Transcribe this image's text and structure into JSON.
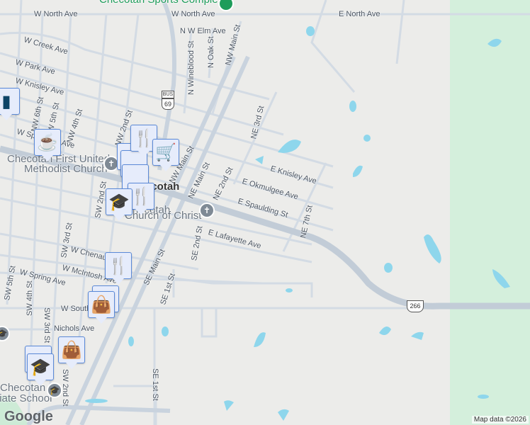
{
  "map": {
    "colors": {
      "land": "#ececea",
      "road": "#d3dbe4",
      "water": "#8ed6ec",
      "park": "#d4efdc",
      "marker_bg": "#e6ecfb",
      "marker_border": "#5b8ad8",
      "marker_icon": "#0d4466"
    },
    "pois": {
      "sports_complex": "Checotah Sports Complex",
      "methodist_line1": "Checotah First United",
      "methodist_line2": "Methodist Church",
      "church_of_christ_line1": "Checotah",
      "church_of_christ_line2": "Church of Christ",
      "town": "Checotah",
      "school_line1": "Checotah",
      "school_line2": "Intermediate School"
    },
    "streets": {
      "w_north_1": "W North Ave",
      "w_north_2": "W North Ave",
      "e_north": "E North Ave",
      "nw_elm": "N W Elm Ave",
      "w_creek": "W Creek Ave",
      "w_park": "W Park Ave",
      "w_knisley": "W Knisley Ave",
      "nw6": "NW 6th St",
      "nw5": "NW 5th St",
      "nw4": "NW 4th St",
      "nw2": "NW 2nd St",
      "wineblood": "N Wineblood St",
      "oak": "N Oak St",
      "nw_main": "NW Main St",
      "nw_main2": "NW Main St",
      "ne3": "NE 3rd St",
      "w_spaulding": "W Spaulding Ave",
      "ne_main": "NE Main St",
      "ne2": "NE 2nd St",
      "e_knisley": "E Knisley Ave",
      "e_okmulgee": "E Okmulgee Ave",
      "e_spaulding": "E Spaulding St",
      "ne7": "NE 7th St",
      "sw2": "SW 2nd St",
      "se2": "SE 2nd St",
      "e_lafayette": "E Lafayette Ave",
      "sw3": "SW 3rd St",
      "w_chenault": "W Chenault Ave",
      "w_mcintosh": "W McIntosh Ave",
      "w_spring": "W Spring Ave",
      "sw5": "SW 5th St",
      "sw4": "SW 4th St",
      "se_main": "SE Main St",
      "se1": "SE 1st St",
      "se1b": "SE 1st St",
      "w_south": "W South Ave",
      "nichols": "Nichols Ave",
      "sw3b": "SW 3rd St",
      "sw2b": "SW 2nd St"
    },
    "shields": {
      "bus_label": "BUS",
      "bus_route": "69",
      "us_route": "266"
    },
    "markers": [
      {
        "type": "restaurant",
        "icon": "fork-knife-icon",
        "glyph": "🍴"
      },
      {
        "type": "grocery",
        "icon": "shopping-cart-icon",
        "glyph": "🛒"
      },
      {
        "type": "cafe",
        "icon": "coffee-cup-icon",
        "glyph": "☕"
      },
      {
        "type": "school",
        "icon": "graduation-cap-icon",
        "glyph": "🎓"
      },
      {
        "type": "restaurant",
        "icon": "fork-knife-icon",
        "glyph": "🍴"
      },
      {
        "type": "shopping",
        "icon": "shopping-bag-icon",
        "glyph": "👜"
      },
      {
        "type": "shopping",
        "icon": "shopping-bag-icon",
        "glyph": "👜"
      },
      {
        "type": "school",
        "icon": "graduation-cap-icon",
        "glyph": "🎓"
      },
      {
        "type": "restaurant",
        "icon": "fork-knife-icon",
        "glyph": "🍴"
      }
    ],
    "attribution": {
      "logo": "Google",
      "data": "Map data ©2026"
    }
  }
}
